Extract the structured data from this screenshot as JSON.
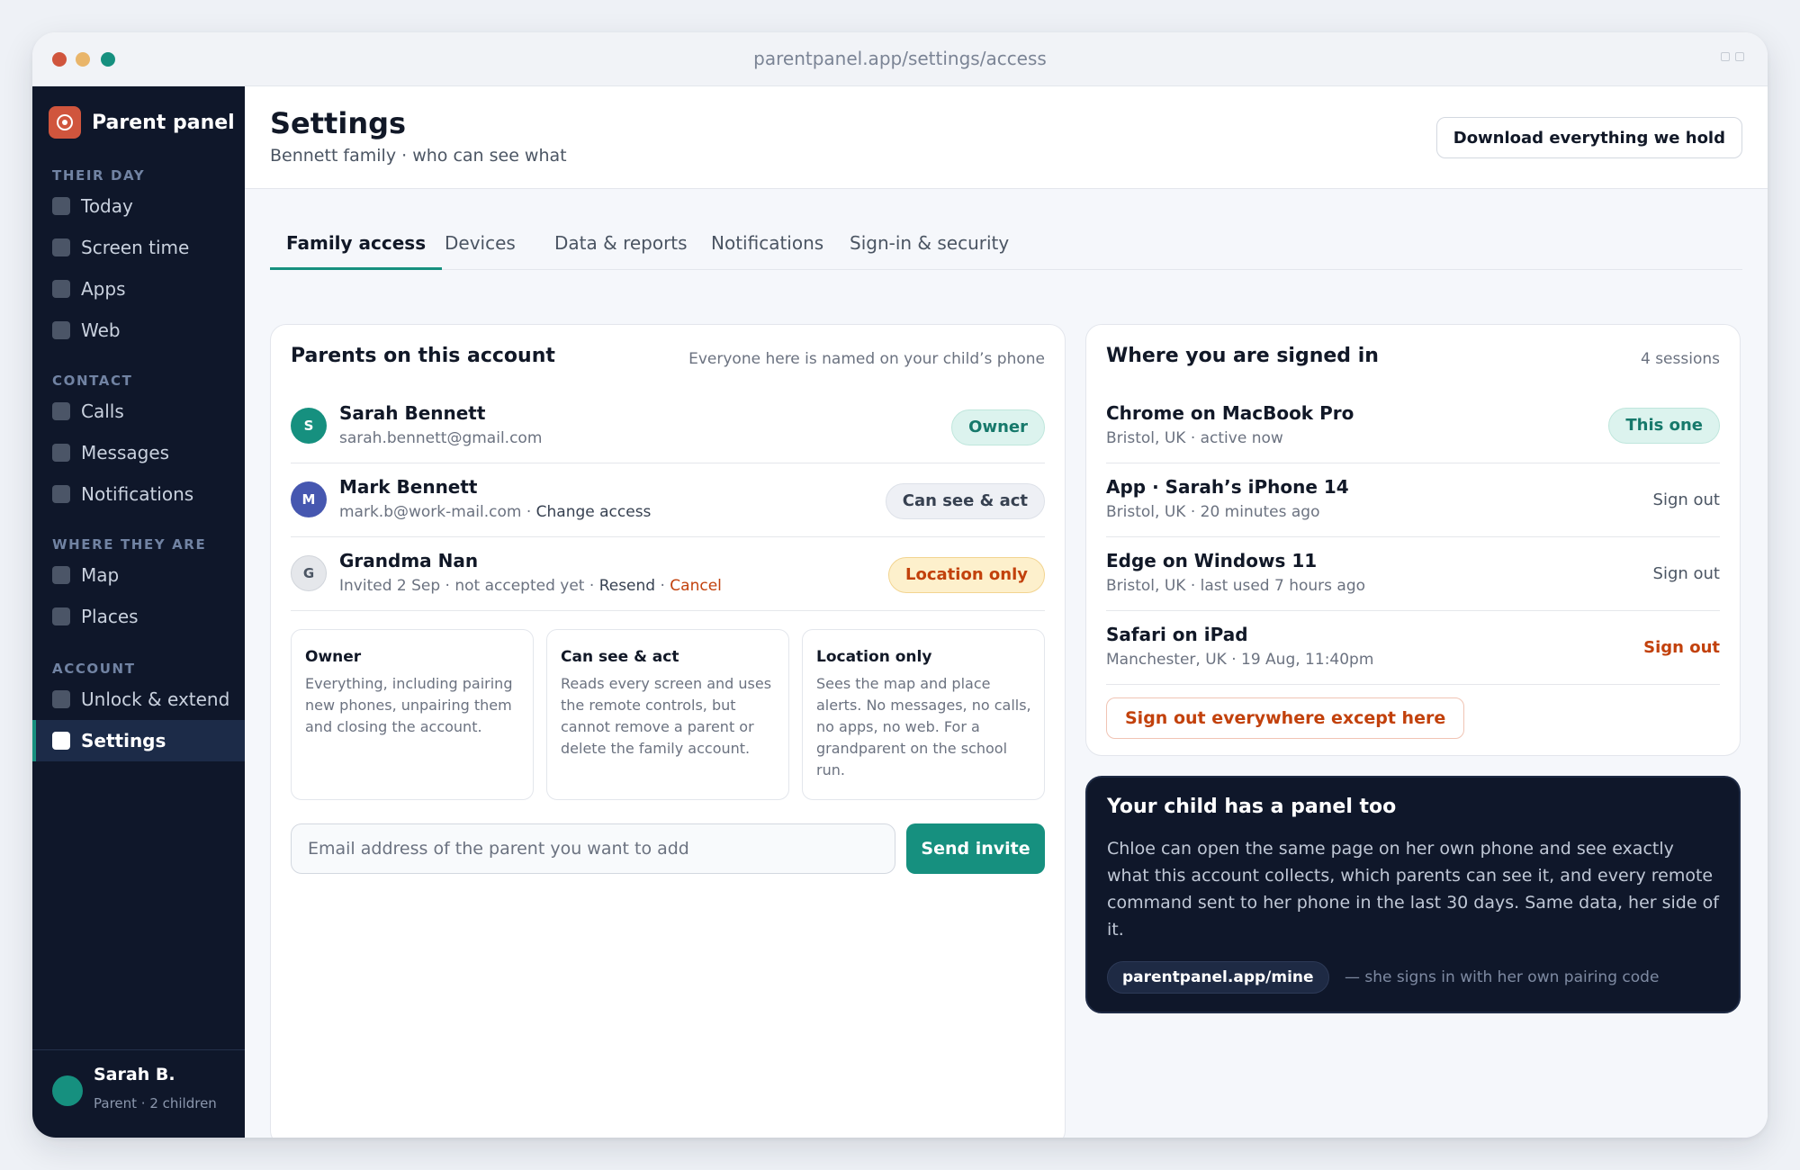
{
  "window": {
    "url": "parentpanel.app/settings/access"
  },
  "sidebar": {
    "brand": "Parent panel",
    "sections": [
      {
        "title": "THEIR DAY",
        "items": [
          "Today",
          "Screen time",
          "Apps",
          "Web"
        ]
      },
      {
        "title": "CONTACT",
        "items": [
          "Calls",
          "Messages",
          "Notifications"
        ]
      },
      {
        "title": "WHERE THEY ARE",
        "items": [
          "Map",
          "Places"
        ]
      },
      {
        "title": "ACCOUNT",
        "items": [
          "Unlock & extend",
          "Settings"
        ]
      }
    ],
    "active_item": "Settings",
    "user": {
      "name": "Sarah B.",
      "role": "Parent · 2 children"
    }
  },
  "header": {
    "title": "Settings",
    "subtitle": "Bennett family · who can see what",
    "download_label": "Download everything we hold"
  },
  "tabs": [
    "Family access",
    "Devices",
    "Data & reports",
    "Notifications",
    "Sign-in & security"
  ],
  "active_tab": "Family access",
  "parents": {
    "title": "Parents on this account",
    "meta": "Everyone here is named on your child’s phone",
    "people": [
      {
        "initial": "S",
        "name": "Sarah Bennett",
        "detail": "sarah.bennett@gmail.com",
        "role": "Owner",
        "avatar_color": "#16907f"
      },
      {
        "initial": "M",
        "name": "Mark Bennett",
        "detail": "mark.b@work-mail.com · ",
        "link": "Change access",
        "role": "Can see & act",
        "avatar_color": "#4657b0"
      },
      {
        "initial": "G",
        "name": "Grandma Nan",
        "detail": "Invited 2 Sep · not accepted yet · ",
        "link": "Resend",
        "sep": " · ",
        "cancel": "Cancel",
        "role": "Location only",
        "avatar_color": "#e5e7eb"
      }
    ],
    "roles": [
      {
        "title": "Owner",
        "desc": "Everything, including pairing new phones, unpairing them and closing the account."
      },
      {
        "title": "Can see & act",
        "desc": "Reads every screen and uses the remote controls, but cannot remove a parent or delete the family account."
      },
      {
        "title": "Location only",
        "desc": "Sees the map and place alerts. No messages, no calls, no apps, no web. For a grandparent on the school run."
      }
    ],
    "invite_placeholder": "Email address of the parent you want to add",
    "invite_button": "Send invite"
  },
  "sessions": {
    "title": "Where you are signed in",
    "meta": "4 sessions",
    "items": [
      {
        "name": "Chrome on MacBook Pro",
        "detail": "Bristol, UK · active now",
        "action": "This one"
      },
      {
        "name": "App · Sarah’s iPhone 14",
        "detail": "Bristol, UK · 20 minutes ago",
        "action": "Sign out"
      },
      {
        "name": "Edge on Windows 11",
        "detail": "Bristol, UK · last used 7 hours ago",
        "action": "Sign out"
      },
      {
        "name": "Safari on iPad",
        "detail": "Manchester, UK · 19 Aug, 11:40pm",
        "action": "Sign out"
      }
    ],
    "sign_out_all": "Sign out everywhere except here"
  },
  "child_panel": {
    "title": "Your child has a panel too",
    "desc": "Chloe can open the same page on her own phone and see exactly what this account collects, which parents can see it, and every remote command sent to her phone in the last 30 days. Same data, her side of it.",
    "link": "parentpanel.app/mine",
    "note": "— she signs in with her own pairing code"
  },
  "colors": {
    "accent": "#16907f",
    "danger": "#c2410c",
    "sidebar": "#0f172a",
    "brand": "#d0553d"
  }
}
